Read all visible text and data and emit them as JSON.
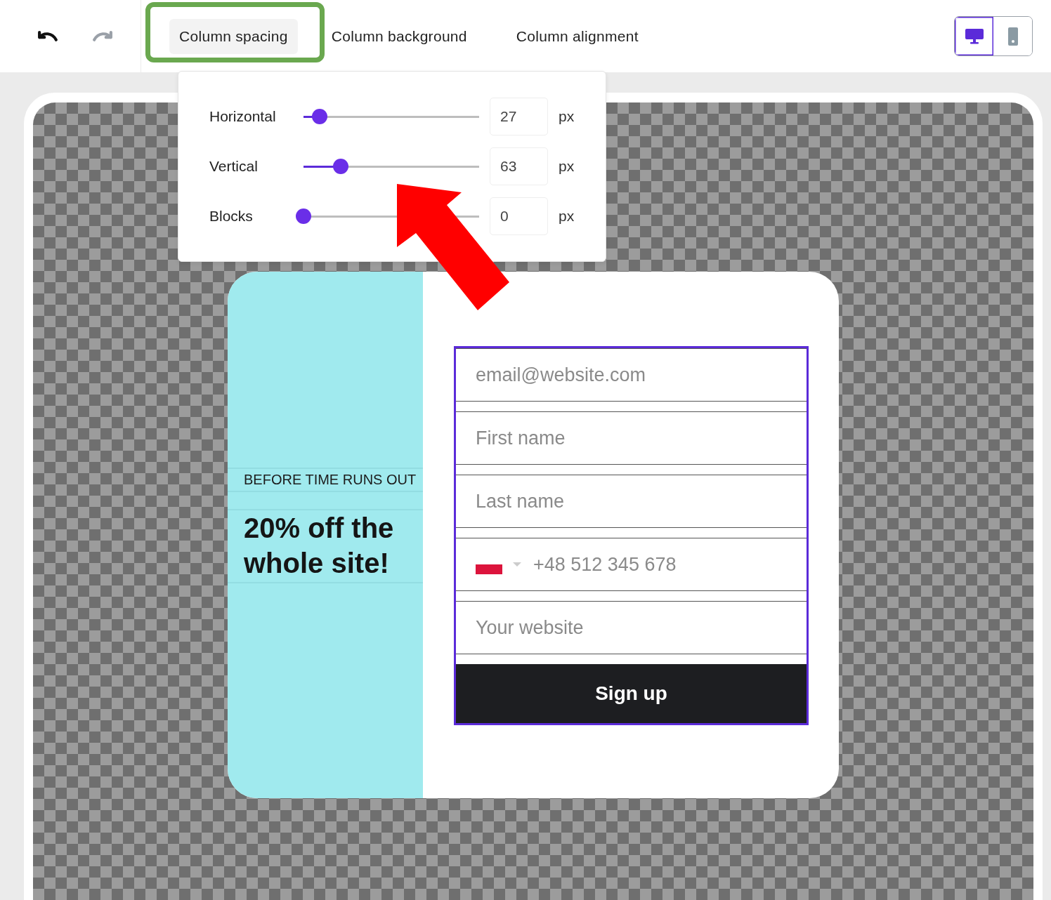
{
  "toolbar": {
    "undo": {
      "disabled": false
    },
    "redo": {
      "disabled": true
    }
  },
  "tabs": [
    {
      "label": "Column spacing",
      "selected": true,
      "highlighted": true
    },
    {
      "label": "Column background",
      "selected": false,
      "highlighted": false
    },
    {
      "label": "Column alignment",
      "selected": false,
      "highlighted": false
    }
  ],
  "device_toggle": [
    {
      "kind": "desktop",
      "selected": true
    },
    {
      "kind": "mobile",
      "selected": false
    }
  ],
  "spacing_popover": {
    "rows": [
      {
        "label": "Horizontal",
        "level": 0.09,
        "value": "27",
        "unit": "px"
      },
      {
        "label": "Vertical",
        "level": 0.21,
        "value": "63",
        "unit": "px"
      },
      {
        "label": "Blocks",
        "level": 0,
        "value": "0",
        "unit": "px"
      }
    ]
  },
  "signup_card": {
    "eyebrow": "BEFORE TIME RUNS OUT",
    "headline": "20% off the whole site!",
    "fields": [
      {
        "kind": "text",
        "placeholder": "email@website.com"
      },
      {
        "kind": "text",
        "placeholder": "First name"
      },
      {
        "kind": "text",
        "placeholder": "Last name"
      },
      {
        "kind": "phone",
        "placeholder": "+48 512 345 678"
      },
      {
        "kind": "text",
        "placeholder": "Your website"
      }
    ],
    "button": "Sign up"
  }
}
